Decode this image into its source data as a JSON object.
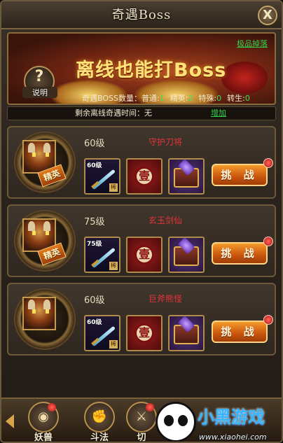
{
  "window": {
    "title": "奇遇Boss",
    "close_label": "X"
  },
  "banner": {
    "link_text": "极品掉落",
    "headline": "离线也能打Boss",
    "help_label": "说明",
    "help_glyph": "?",
    "counts": {
      "title": "奇遇BOSS数量：",
      "items": [
        {
          "label": "普通:",
          "value": "1"
        },
        {
          "label": "精英:",
          "value": "2"
        },
        {
          "label": "特殊:",
          "value": "0"
        },
        {
          "label": "转生:",
          "value": "0"
        }
      ]
    }
  },
  "remaining": {
    "label": "剩余离线奇遇时间：无",
    "add_label": "增加"
  },
  "bosses": [
    {
      "level": "60级",
      "name": "守护刀将",
      "elite_label": "精英",
      "weapon_level": "60级",
      "weapon_tag": "稀",
      "seal_glyph": "壹",
      "challenge": "挑 战"
    },
    {
      "level": "75级",
      "name": "玄玉剑仙",
      "elite_label": "精英",
      "weapon_level": "75级",
      "weapon_tag": "稀",
      "seal_glyph": "壹",
      "challenge": "挑 战"
    },
    {
      "level": "60级",
      "name": "巨斧熊怪",
      "weapon_level": "60级",
      "weapon_tag": "稀",
      "seal_glyph": "壹",
      "challenge": "挑 战"
    }
  ],
  "bottom_nav": [
    {
      "label": "妖兽",
      "icon": "eye-icon",
      "glyph": "◉"
    },
    {
      "label": "斗法",
      "icon": "fist-icon",
      "glyph": "✊"
    },
    {
      "label": "切",
      "icon": "sword-icon",
      "glyph": "⚔"
    }
  ],
  "watermark": {
    "brand": "小黑游戏",
    "url": "www.xiaohei.com"
  },
  "colors": {
    "accent_orange": "#e07a1b",
    "link_green": "#2fd24c",
    "boss_name_red": "#e2343a",
    "gold_border": "#b08c4c"
  }
}
